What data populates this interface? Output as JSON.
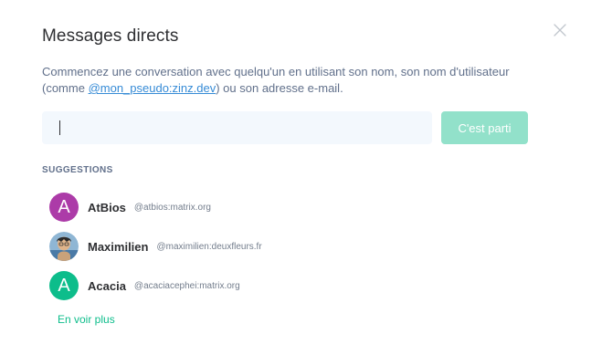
{
  "dialog": {
    "title": "Messages directs",
    "intro_before": "Commencez une conversation avec quelqu'un en utilisant son nom, son nom d'utilisateur (comme ",
    "intro_link": "@mon_pseudo:zinz.dev",
    "intro_after": ") ou son adresse e-mail.",
    "search": {
      "value": "",
      "placeholder": ""
    },
    "go_button": "C'est parti",
    "suggestions_title": "SUGGESTIONS",
    "suggestions": [
      {
        "initial": "A",
        "name": "AtBios",
        "user_id": "@atbios:matrix.org",
        "avatar_color": "#ac3ba8"
      },
      {
        "initial": "",
        "name": "Maximilien",
        "user_id": "@maximilien:deuxfleurs.fr",
        "avatar_color": "#5a8bb5"
      },
      {
        "initial": "A",
        "name": "Acacia",
        "user_id": "@acaciacephei:matrix.org",
        "avatar_color": "#0dbd8b"
      }
    ],
    "more_link": "En voir plus"
  },
  "colors": {
    "accent": "#0dbd8b",
    "button_disabled": "#92e1ca",
    "link": "#368bd6",
    "input_bg": "#f3f8fd"
  }
}
